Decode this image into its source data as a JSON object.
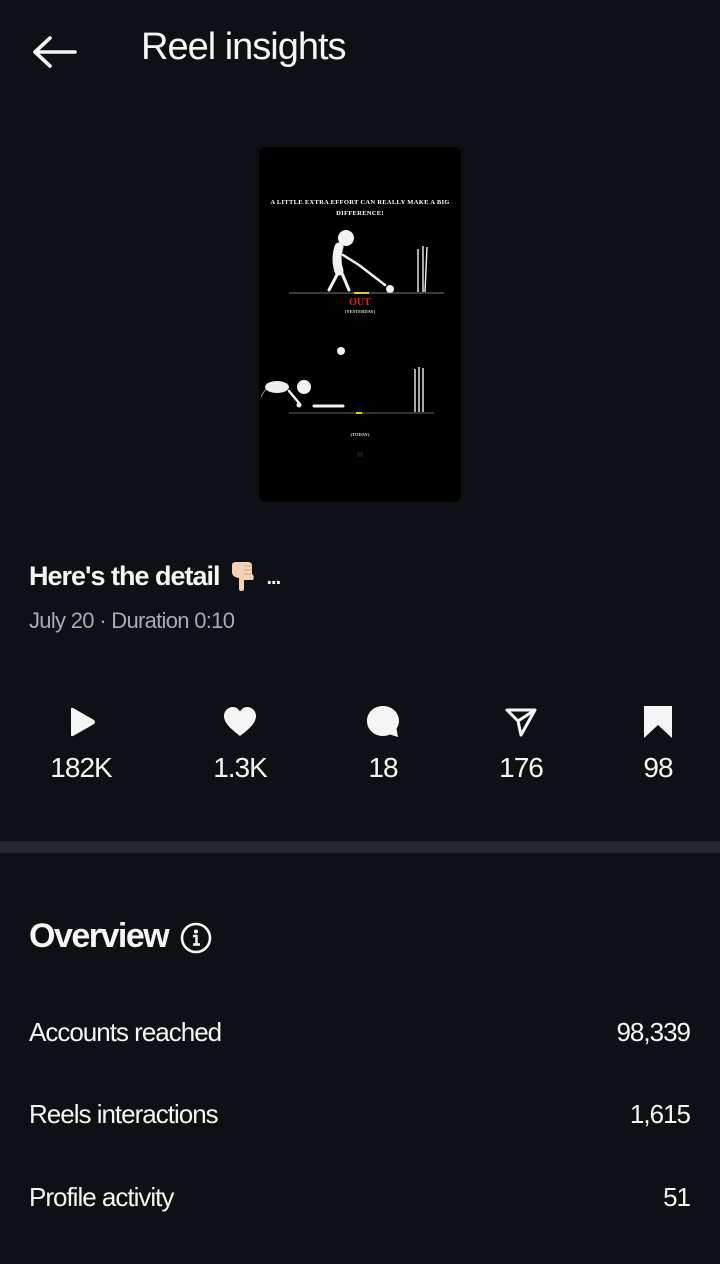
{
  "header": {
    "title": "Reel insights"
  },
  "reel": {
    "thumbnail": {
      "caption": "A little extra effort can really make a big difference!",
      "out_label": "OUT",
      "yesterday_label": "(Yesterday)",
      "today_label": "(Today)",
      "watermark": "M"
    },
    "title": "Here's the detail",
    "title_more": "...",
    "meta": "July 20 · Duration 0:10"
  },
  "stats": {
    "plays": "182K",
    "likes": "1.3K",
    "comments": "18",
    "shares": "176",
    "saves": "98"
  },
  "overview": {
    "title": "Overview",
    "rows": [
      {
        "label": "Accounts reached",
        "value": "98,339"
      },
      {
        "label": "Reels interactions",
        "value": "1,615"
      },
      {
        "label": "Profile activity",
        "value": "51"
      }
    ]
  },
  "icons": [
    "back-arrow-icon",
    "play-icon",
    "heart-icon",
    "comment-icon",
    "share-icon",
    "bookmark-icon",
    "info-icon",
    "pointing-hand-icon"
  ]
}
